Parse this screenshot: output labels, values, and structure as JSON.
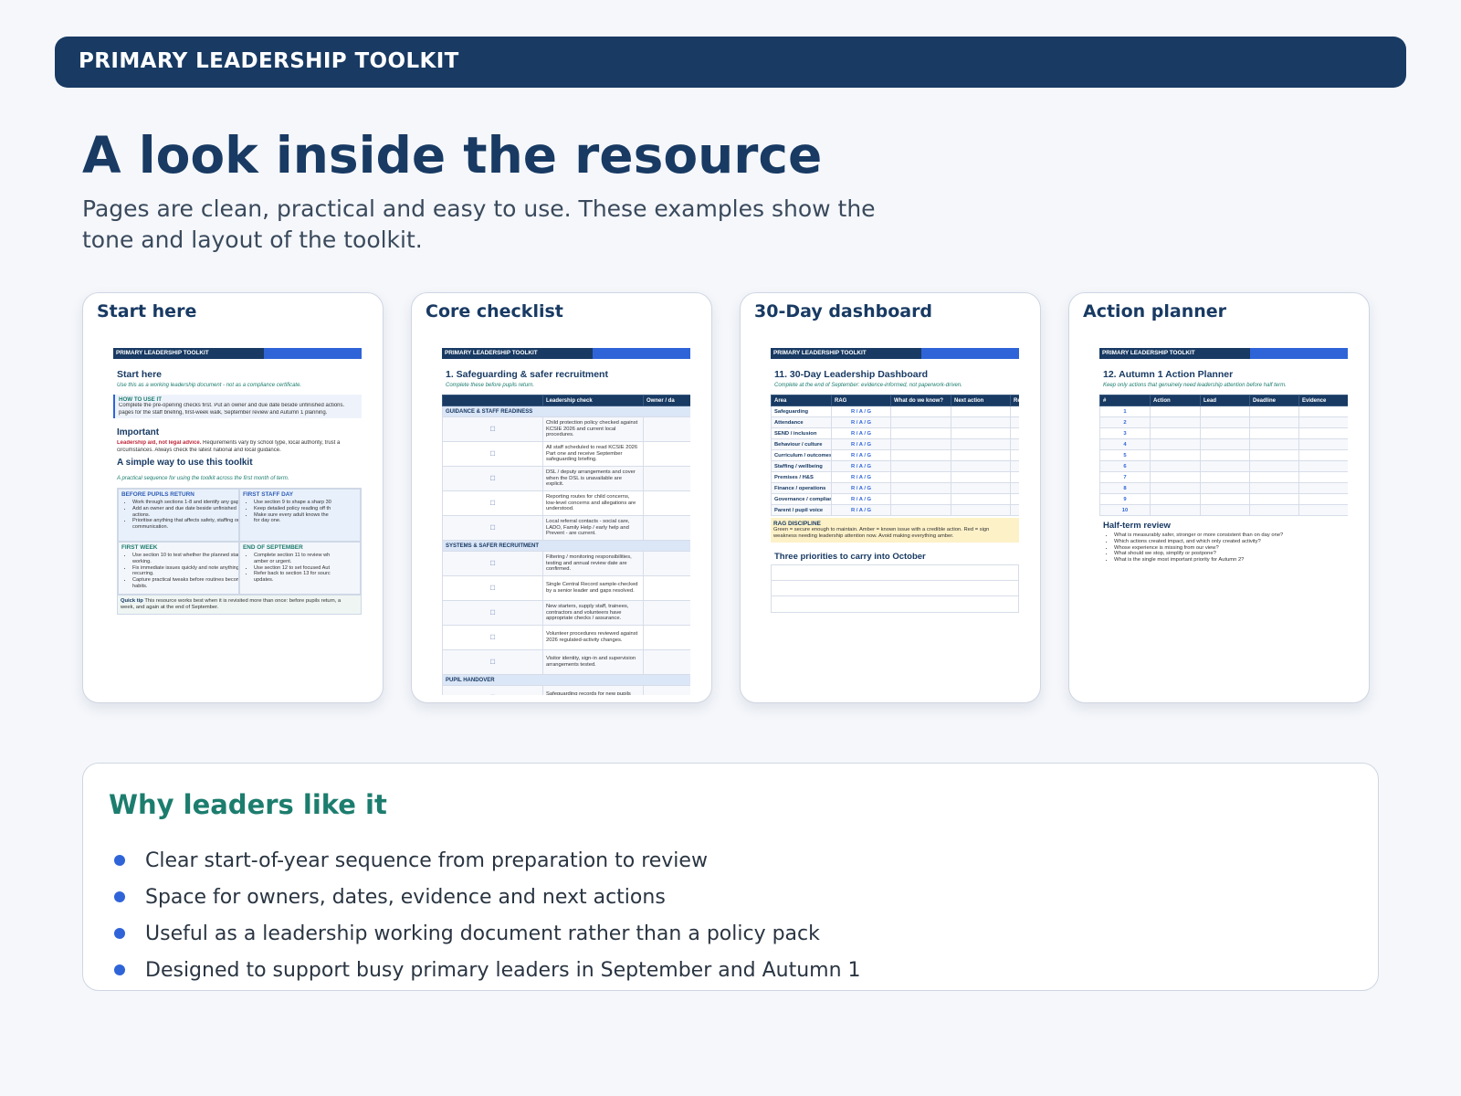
{
  "banner": {
    "title": "PRIMARY LEADERSHIP TOOLKIT"
  },
  "heading": "A look inside the resource",
  "lead": "Pages are clean, practical and easy to use. These examples show the tone and layout of the toolkit.",
  "colors": {
    "navy": "#183a63",
    "blue": "#2f64d8",
    "teal": "#1c7d6e",
    "background": "#f5f7fb"
  },
  "cards": [
    {
      "title": "Start here",
      "doc": {
        "header": "PRIMARY LEADERSHIP TOOLKIT",
        "heading": "Start here",
        "subtitle": "Use this as a working leadership document - not as a compliance certificate.",
        "howto_title": "HOW TO USE IT",
        "howto_lines": [
          "Complete the pre-opening checks first. Put an owner and due date beside unfinished actions.",
          "pages for the staff briefing, first-week walk, September review and Autumn 1 planning."
        ],
        "important_title": "Important",
        "important_bold": "Leadership aid, not legal advice.",
        "important_line1": " Requirements vary by school type, local authority, trust a",
        "important_line2": "circumstances. Always check the latest national and local guidance.",
        "sequence_title": "A simple way to use this toolkit",
        "sequence_subtitle": "A practical sequence for using the toolkit across the first month of term.",
        "blocks": [
          {
            "title": "BEFORE PUPILS RETURN",
            "items": [
              "Work through sections 1-8 and identify any gaps.",
              "Add an owner and due date beside unfinished",
              "actions.",
              "Prioritise anything that affects safety, staffing or",
              "communication."
            ]
          },
          {
            "title": "FIRST STAFF DAY",
            "items": [
              "Use section 9 to shape a sharp 30",
              "Keep detailed policy reading off th",
              "Make sure every adult knows the",
              "for day one."
            ]
          },
          {
            "title": "FIRST WEEK",
            "items": [
              "Use section 10 to test whether the planned start is",
              "working.",
              "Fix immediate issues quickly and note anything",
              "recurring.",
              "Capture practical tweaks before routines become",
              "habits."
            ]
          },
          {
            "title": "END OF SEPTEMBER",
            "items": [
              "Complete section 11 to review wh",
              "amber or urgent.",
              "Use section 12 to set focused Aut",
              "Refer back to section 13 for sourc",
              "updates."
            ]
          }
        ],
        "tip_label": "Quick tip",
        "tip_line1": " This resource works best when it is revisited more than once: before pupils return, a",
        "tip_line2": "week, and again at the end of September."
      }
    },
    {
      "title": "Core checklist",
      "doc": {
        "header": "PRIMARY LEADERSHIP TOOLKIT",
        "heading": "1. Safeguarding & safer recruitment",
        "subtitle": "Complete these before pupils return.",
        "columns": [
          "",
          "Leadership check",
          "Owner / da"
        ],
        "sections": [
          {
            "name": "GUIDANCE & STAFF READINESS",
            "rows": [
              "Child protection policy checked against KCSIE 2026 and current local procedures.",
              "All staff scheduled to read KCSIE 2026 Part one and receive September safeguarding briefing.",
              "DSL / deputy arrangements and cover when the DSL is unavailable are explicit.",
              "Reporting routes for child concerns, low-level concerns and allegations are understood.",
              "Local referral contacts - social care, LADO, Family Help / early help and Prevent - are current."
            ]
          },
          {
            "name": "SYSTEMS & SAFER RECRUITMENT",
            "rows": [
              "Filtering / monitoring responsibilities, testing and annual review date are confirmed.",
              "Single Central Record sample-checked by a senior leader and gaps resolved.",
              "New starters, supply staff, trainees, contractors and volunteers have appropriate checks / assurance.",
              "Volunteer procedures reviewed against 2026 regulated-activity changes.",
              "Visitor identity, sign-in and supervision arrangements tested."
            ]
          },
          {
            "name": "PUPIL HANDOVER",
            "rows": [
              "Safeguarding records for new pupils requested / transferred securely and"
            ]
          }
        ]
      }
    },
    {
      "title": "30-Day dashboard",
      "doc": {
        "header": "PRIMARY LEADERSHIP TOOLKIT",
        "heading": "11. 30-Day Leadership Dashboard",
        "subtitle": "Complete at the end of September: evidence-informed, not paperwork-driven.",
        "columns": [
          "Area",
          "RAG",
          "What do we know?",
          "Next action",
          "Re"
        ],
        "rag_label": "R / A / G",
        "areas": [
          "Safeguarding",
          "Attendance",
          "SEND / inclusion",
          "Behaviour / culture",
          "Curriculum / outcomes",
          "Staffing / wellbeing",
          "Premises / H&S",
          "Finance / operations",
          "Governance / compliance",
          "Parent / pupil voice"
        ],
        "rag_title": "RAG DISCIPLINE",
        "rag_line1": "Green = secure enough to maintain. Amber = known issue with a credible action. Red = sign",
        "rag_line2": "weakness needing leadership attention now. Avoid making everything amber.",
        "priorities_title": "Three priorities to carry into October"
      }
    },
    {
      "title": "Action planner",
      "doc": {
        "header": "PRIMARY LEADERSHIP TOOLKIT",
        "heading": "12. Autumn 1 Action Planner",
        "subtitle": "Keep only actions that genuinely need leadership attention before half term.",
        "columns": [
          "#",
          "Action",
          "Lead",
          "Deadline",
          "Evidence"
        ],
        "rows": [
          "1",
          "2",
          "3",
          "4",
          "5",
          "6",
          "7",
          "8",
          "9",
          "10"
        ],
        "review_title": "Half-term review",
        "review_items": [
          "What is measurably safer, stronger or more consistent than on day one?",
          "Which actions created impact, and which only created activity?",
          "Whose experience is missing from our view?",
          "What should we stop, simplify or postpone?",
          "What is the single most important priority for Autumn 2?"
        ]
      }
    }
  ],
  "why": {
    "title": "Why leaders like it",
    "items": [
      "Clear start-of-year sequence from preparation to review",
      "Space for owners, dates, evidence and next actions",
      "Useful as a leadership working document rather than a policy pack",
      "Designed to support busy primary leaders in September and Autumn 1"
    ]
  }
}
